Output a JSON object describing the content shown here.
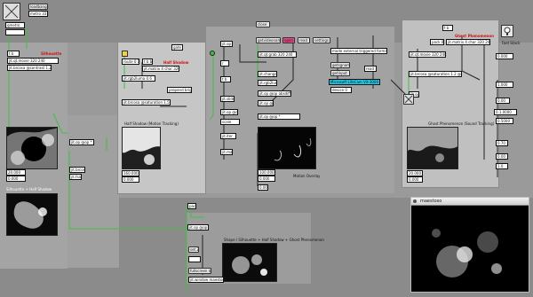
{
  "window": {
    "corner_box": "×",
    "top_left_boxes": [
      "loadbang",
      "metro 33",
      "qmetro"
    ]
  },
  "colors": {
    "canvas": "#8b8b8b",
    "panel_light": "#bdbdbd",
    "panel_mid": "#a4a4a4",
    "panel_dark": "#9a9a9a",
    "wire_green": "#3fbf3f",
    "wire_dark": "#202020",
    "accent_pink": "#e94a8a",
    "accent_cyan": "#22c8e6",
    "label_red": "#d01010"
  },
  "left": {
    "section_title": "Silhouette",
    "objects": [
      "t b",
      "jit.qt.movie 320 240",
      "jit.rgb2luma",
      "jit.op @op > @val 0.5",
      "jit.brcosa @contrast 1.2"
    ],
    "video_label": "Silhouette + Half Shadow",
    "readouts": [
      "20.000",
      "0.000"
    ],
    "mid_objects": [
      "jit.op @op *",
      "jit.brcosa",
      "jit.fsa"
    ]
  },
  "center_left": {
    "section_title": "Half Shadow",
    "top_object": "gate",
    "objects": [
      "route 0 1",
      "t b b",
      "jit.matrix 4 char 320 240",
      "jit.rgb2luma 0.6",
      "prepend brightness",
      "jit.brcosa @saturation 1.5"
    ],
    "video_label": "Half Shadow (Motion Tracking)",
    "readouts": [
      "160.000",
      "0.000"
    ]
  },
  "center": {
    "column_objects": [
      "jit.op",
      "r",
      "t b",
      "jit.slide",
      "jit.op @op -",
      "scale",
      "jit.iter",
      "jit.map"
    ],
    "top_row": [
      "close",
      "getvideoname",
      "open",
      "read",
      "settings"
    ],
    "device_box": "read",
    "prop_list": [
      "mode external triggered formatted",
      "getsgname",
      "getinput",
      "Microsoft LifeCam VX-3000",
      "device 0"
    ],
    "mid_objects": [
      "jit.qt.grab 320 240",
      "jit.change",
      "jit.rgb2luma",
      "jit.op @op absdiff",
      "jit.op @op > @val 0.1",
      "jit.op @op *"
    ],
    "video_label": "Motion Overlay",
    "readouts": [
      "100.000",
      "0.000",
      "0.000"
    ]
  },
  "right": {
    "section_title": "Ghost Phenomenon",
    "objects": [
      "t b",
      "pack 0 0",
      "jit.matrix 4 char 320 240",
      "jit.qt.movie 320 240",
      "jit.brcosa @saturation 1.2 @brightness",
      "jit.op @op +"
    ],
    "video_label": "Ghost Phenomenon (Sound Tracking)",
    "readouts": [
      "20.000",
      "0.000"
    ],
    "numbers": [
      "0.000",
      "1.000",
      "0.00",
      "0.1.0000",
      "0.5000",
      "0.70",
      "0.00",
      "1.0"
    ],
    "toggle_label": "Fast Stack"
  },
  "bottom": {
    "title": "Shape / Silhouette + Half Shadow + Ghost Phenomenon",
    "objects": [
      "jit.op @op *",
      "pack",
      "set 2",
      "fullscreen $1",
      "jit.window maestoso"
    ]
  },
  "floating_window": {
    "title": "maestoso"
  }
}
